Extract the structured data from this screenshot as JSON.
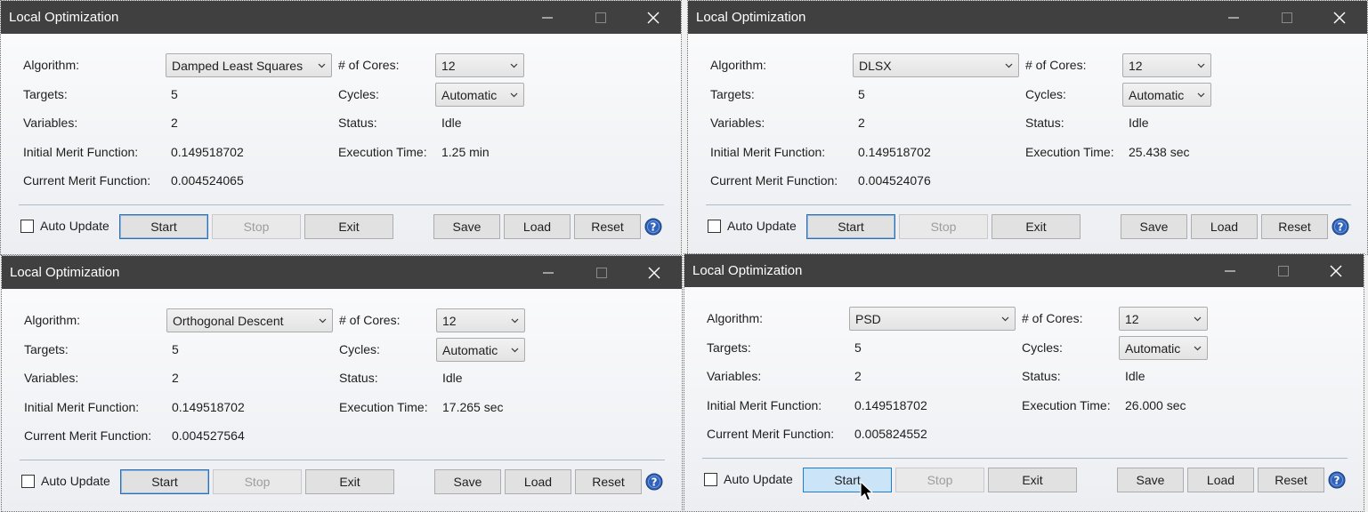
{
  "windows": [
    {
      "title": "Local Optimization",
      "labels": {
        "algorithm": "Algorithm:",
        "targets": "Targets:",
        "variables": "Variables:",
        "initial_merit": "Initial Merit Function:",
        "current_merit": "Current Merit Function:",
        "cores": "# of Cores:",
        "cycles": "Cycles:",
        "status": "Status:",
        "execution_time": "Execution Time:"
      },
      "algorithm": "Damped Least Squares",
      "targets": "5",
      "variables": "2",
      "initial_merit": "0.149518702",
      "current_merit": "0.004524065",
      "cores": "12",
      "cycles": "Automatic",
      "status": "Idle",
      "execution_time": "1.25 min",
      "auto_update": "Auto Update",
      "buttons": {
        "start": "Start",
        "stop": "Stop",
        "exit": "Exit",
        "save": "Save",
        "load": "Load",
        "reset": "Reset"
      }
    },
    {
      "title": "Local Optimization",
      "labels": {
        "algorithm": "Algorithm:",
        "targets": "Targets:",
        "variables": "Variables:",
        "initial_merit": "Initial Merit Function:",
        "current_merit": "Current Merit Function:",
        "cores": "# of Cores:",
        "cycles": "Cycles:",
        "status": "Status:",
        "execution_time": "Execution Time:"
      },
      "algorithm": "DLSX",
      "targets": "5",
      "variables": "2",
      "initial_merit": "0.149518702",
      "current_merit": "0.004524076",
      "cores": "12",
      "cycles": "Automatic",
      "status": "Idle",
      "execution_time": "25.438 sec",
      "auto_update": "Auto Update",
      "buttons": {
        "start": "Start",
        "stop": "Stop",
        "exit": "Exit",
        "save": "Save",
        "load": "Load",
        "reset": "Reset"
      }
    },
    {
      "title": "Local Optimization",
      "labels": {
        "algorithm": "Algorithm:",
        "targets": "Targets:",
        "variables": "Variables:",
        "initial_merit": "Initial Merit Function:",
        "current_merit": "Current Merit Function:",
        "cores": "# of Cores:",
        "cycles": "Cycles:",
        "status": "Status:",
        "execution_time": "Execution Time:"
      },
      "algorithm": "Orthogonal Descent",
      "targets": "5",
      "variables": "2",
      "initial_merit": "0.149518702",
      "current_merit": "0.004527564",
      "cores": "12",
      "cycles": "Automatic",
      "status": "Idle",
      "execution_time": "17.265 sec",
      "auto_update": "Auto Update",
      "buttons": {
        "start": "Start",
        "stop": "Stop",
        "exit": "Exit",
        "save": "Save",
        "load": "Load",
        "reset": "Reset"
      }
    },
    {
      "title": "Local Optimization",
      "labels": {
        "algorithm": "Algorithm:",
        "targets": "Targets:",
        "variables": "Variables:",
        "initial_merit": "Initial Merit Function:",
        "current_merit": "Current Merit Function:",
        "cores": "# of Cores:",
        "cycles": "Cycles:",
        "status": "Status:",
        "execution_time": "Execution Time:"
      },
      "algorithm": "PSD",
      "targets": "5",
      "variables": "2",
      "initial_merit": "0.149518702",
      "current_merit": "0.005824552",
      "cores": "12",
      "cycles": "Automatic",
      "status": "Idle",
      "execution_time": "26.000 sec",
      "auto_update": "Auto Update",
      "buttons": {
        "start": "Start",
        "stop": "Stop",
        "exit": "Exit",
        "save": "Save",
        "load": "Load",
        "reset": "Reset"
      }
    }
  ],
  "icons": {
    "minimize": "minimize-icon",
    "maximize": "maximize-icon",
    "close": "close-icon",
    "help": "help-icon",
    "dropdown": "chevron-down-icon",
    "cursor": "mouse-pointer-icon"
  },
  "colors": {
    "titlebar": "#404040",
    "help_blue": "#2f62b8",
    "hover_button": "#cce4f7"
  }
}
